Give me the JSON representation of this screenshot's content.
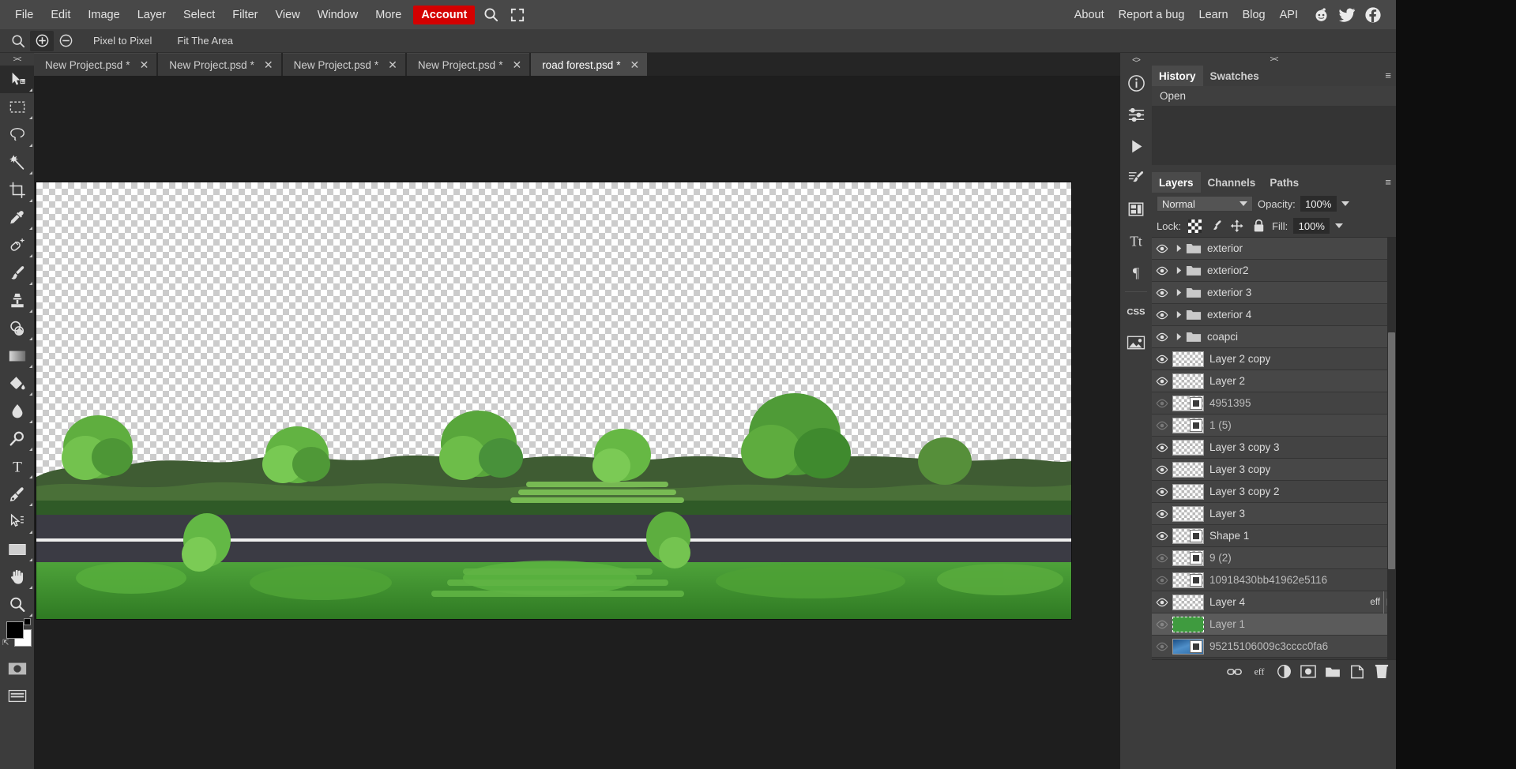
{
  "menubar": {
    "items": [
      {
        "label": "File",
        "name": "menu-file"
      },
      {
        "label": "Edit",
        "name": "menu-edit"
      },
      {
        "label": "Image",
        "name": "menu-image"
      },
      {
        "label": "Layer",
        "name": "menu-layer"
      },
      {
        "label": "Select",
        "name": "menu-select"
      },
      {
        "label": "Filter",
        "name": "menu-filter"
      },
      {
        "label": "View",
        "name": "menu-view"
      },
      {
        "label": "Window",
        "name": "menu-window"
      },
      {
        "label": "More",
        "name": "menu-more"
      }
    ],
    "account_label": "Account",
    "account_color": "#d40000",
    "search_icon": "search-icon",
    "fullscreen_icon": "fullscreen-icon",
    "right_links": [
      "About",
      "Report a bug",
      "Learn",
      "Blog",
      "API"
    ],
    "social": [
      "reddit-icon",
      "twitter-icon",
      "facebook-icon"
    ]
  },
  "optionsbar": {
    "zoom_icon": "magnifier-icon",
    "zoom_in_icon": "zoom-in-icon",
    "zoom_out_icon": "zoom-out-icon",
    "pixel_to_pixel": "Pixel to Pixel",
    "fit_the_area": "Fit The Area"
  },
  "toolbar": {
    "collapse": "><",
    "tools": [
      {
        "name": "move-tool",
        "title": "Move"
      },
      {
        "name": "rectangular-marquee-tool",
        "title": "Marquee"
      },
      {
        "name": "lasso-tool",
        "title": "Lasso"
      },
      {
        "name": "magic-wand-tool",
        "title": "Magic Wand"
      },
      {
        "name": "crop-tool",
        "title": "Crop"
      },
      {
        "name": "eyedropper-tool",
        "title": "Eyedropper"
      },
      {
        "name": "healing-brush-tool",
        "title": "Healing Brush"
      },
      {
        "name": "brush-tool",
        "title": "Brush"
      },
      {
        "name": "clone-stamp-tool",
        "title": "Clone Stamp"
      },
      {
        "name": "eraser-tool",
        "title": "Eraser"
      },
      {
        "name": "gradient-tool",
        "title": "Gradient"
      },
      {
        "name": "paint-bucket-tool",
        "title": "Paint Bucket"
      },
      {
        "name": "blur-tool",
        "title": "Blur"
      },
      {
        "name": "dodge-tool",
        "title": "Dodge"
      },
      {
        "name": "type-tool",
        "title": "Type"
      },
      {
        "name": "pen-tool",
        "title": "Pen"
      },
      {
        "name": "path-selection-tool",
        "title": "Path Selection"
      },
      {
        "name": "shape-tool",
        "title": "Shape"
      },
      {
        "name": "hand-tool",
        "title": "Hand"
      },
      {
        "name": "zoom-tool",
        "title": "Zoom"
      }
    ],
    "foreground_color": "#000000",
    "background_color": "#ffffff",
    "quick_mask_icon": "quick-mask-icon",
    "screen_mode_icon": "screen-mode-icon"
  },
  "tabs": [
    {
      "title": "New Project.psd",
      "modified": "*",
      "active": false
    },
    {
      "title": "New Project.psd",
      "modified": "*",
      "active": false
    },
    {
      "title": "New Project.psd",
      "modified": "*",
      "active": false
    },
    {
      "title": "New Project.psd",
      "modified": "*",
      "active": false
    },
    {
      "title": "road forest.psd",
      "modified": "*",
      "active": true
    }
  ],
  "tab_close_glyph": "✕",
  "dock_icons": [
    {
      "name": "info-icon"
    },
    {
      "name": "adjustments-icon"
    },
    {
      "name": "actions-play-icon"
    },
    {
      "name": "brush-settings-icon"
    },
    {
      "name": "layer-comps-icon"
    },
    {
      "name": "character-icon"
    },
    {
      "name": "paragraph-icon"
    },
    {
      "name": "css-icon"
    },
    {
      "name": "image-icon"
    }
  ],
  "dock_collapse": "<>",
  "history_panel": {
    "grip": "><",
    "tabs": [
      {
        "label": "History",
        "active": true
      },
      {
        "label": "Swatches",
        "active": false
      }
    ],
    "menu_glyph": "≡",
    "items": [
      "Open"
    ]
  },
  "layers_panel": {
    "tabs": [
      {
        "label": "Layers",
        "active": true
      },
      {
        "label": "Channels",
        "active": false
      },
      {
        "label": "Paths",
        "active": false
      }
    ],
    "menu_glyph": "≡",
    "blend_mode": "Normal",
    "opacity_label": "Opacity:",
    "opacity_value": "100%",
    "lock_label": "Lock:",
    "lock_icons": [
      "lock-transparency-icon",
      "lock-image-icon",
      "lock-position-icon",
      "lock-all-icon"
    ],
    "fill_label": "Fill:",
    "fill_value": "100%",
    "layers": [
      {
        "name": "exterior",
        "type": "group",
        "visible": true,
        "selected": false
      },
      {
        "name": "exterior2",
        "type": "group",
        "visible": true,
        "selected": false
      },
      {
        "name": "exterior 3",
        "type": "group",
        "visible": true,
        "selected": false
      },
      {
        "name": "exterior 4",
        "type": "group",
        "visible": true,
        "selected": false
      },
      {
        "name": "coapci",
        "type": "group",
        "visible": true,
        "selected": false
      },
      {
        "name": "Layer 2 copy",
        "type": "raster",
        "visible": true,
        "selected": false
      },
      {
        "name": "Layer 2",
        "type": "raster",
        "visible": true,
        "selected": false
      },
      {
        "name": "4951395",
        "type": "masked",
        "visible": false,
        "selected": false
      },
      {
        "name": "1 (5)",
        "type": "masked",
        "visible": false,
        "selected": false
      },
      {
        "name": "Layer 3 copy 3",
        "type": "raster",
        "visible": true,
        "selected": false
      },
      {
        "name": "Layer 3 copy",
        "type": "raster",
        "visible": true,
        "selected": false
      },
      {
        "name": "Layer 3 copy 2",
        "type": "raster",
        "visible": true,
        "selected": false
      },
      {
        "name": "Layer 3",
        "type": "raster",
        "visible": true,
        "selected": false
      },
      {
        "name": "Shape 1",
        "type": "masked",
        "visible": true,
        "selected": false
      },
      {
        "name": "9 (2)",
        "type": "masked",
        "visible": false,
        "selected": false
      },
      {
        "name": "10918430bb41962e5116",
        "type": "masked",
        "visible": false,
        "selected": false
      },
      {
        "name": "Layer 4",
        "type": "raster",
        "visible": true,
        "selected": false,
        "effects": "eff"
      },
      {
        "name": "Layer 1",
        "type": "green",
        "visible": false,
        "selected": true
      },
      {
        "name": "95215106009c3cccc0fa6",
        "type": "blue-masked",
        "visible": false,
        "selected": false
      }
    ],
    "footer_icons": [
      {
        "name": "link-layers-icon"
      },
      {
        "name": "layer-effects-icon",
        "label": "eff"
      },
      {
        "name": "adjustment-layer-icon"
      },
      {
        "name": "layer-mask-icon"
      },
      {
        "name": "new-group-icon"
      },
      {
        "name": "new-layer-icon"
      },
      {
        "name": "delete-layer-icon"
      }
    ]
  },
  "canvas": {
    "document_name": "road forest.psd",
    "transparency_checker": true,
    "scene_description": "forest tree line with road and grass on transparent background"
  }
}
